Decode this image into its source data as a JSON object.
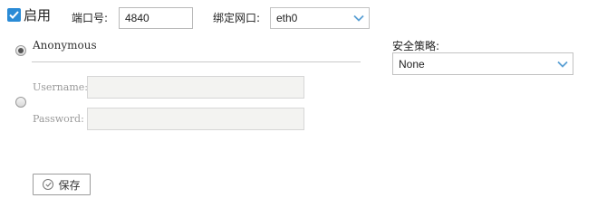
{
  "enable": {
    "label": "启用",
    "checked": true
  },
  "port": {
    "label": "端口号:",
    "value": "4840"
  },
  "bind_interface": {
    "label": "绑定网口:",
    "selected": "eth0"
  },
  "security_policy": {
    "label": "安全策略:",
    "selected": "None"
  },
  "auth": {
    "anonymous_label": "Anonymous",
    "anonymous_selected": true,
    "username_label": "Username:",
    "password_label": "Password:"
  },
  "save_button": {
    "label": "保存"
  },
  "colors": {
    "accent": "#2a8bd6",
    "chevron": "#5a9fd4"
  }
}
